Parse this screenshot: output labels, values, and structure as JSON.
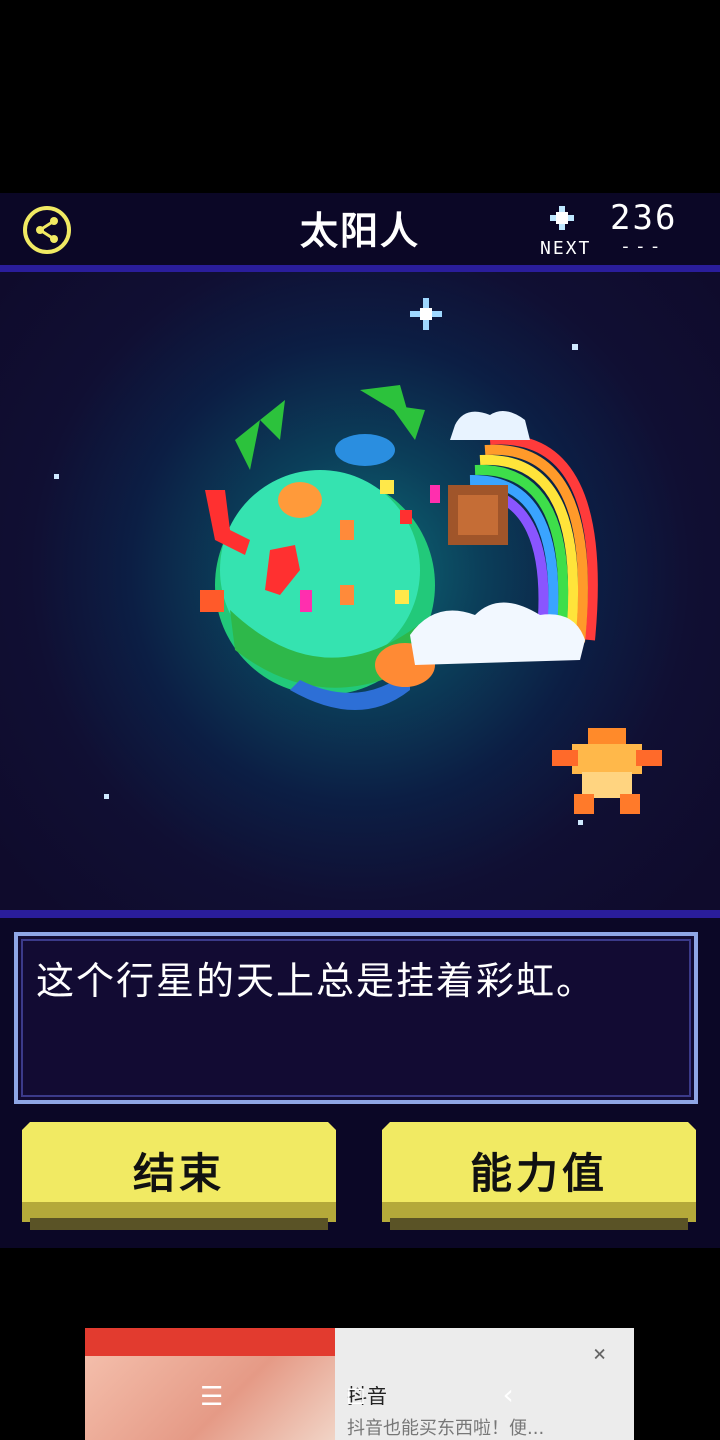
{
  "header": {
    "title": "太阳人",
    "next_label": "NEXT",
    "score": "236",
    "score_sub": "---",
    "share_icon": "share-icon"
  },
  "dialog": {
    "text": "这个行星的天上总是挂着彩虹。"
  },
  "buttons": {
    "end_label": "结束",
    "stats_label": "能力值"
  },
  "ad": {
    "title": "抖音",
    "description": "抖音也能买东西啦！便...",
    "close": "×"
  },
  "nav": {
    "menu": "☰",
    "home": "□",
    "back": "‹"
  },
  "colors": {
    "accent_yellow": "#f1ea63",
    "header_bg": "#0b0726",
    "rule_blue": "#2a1d9b"
  }
}
